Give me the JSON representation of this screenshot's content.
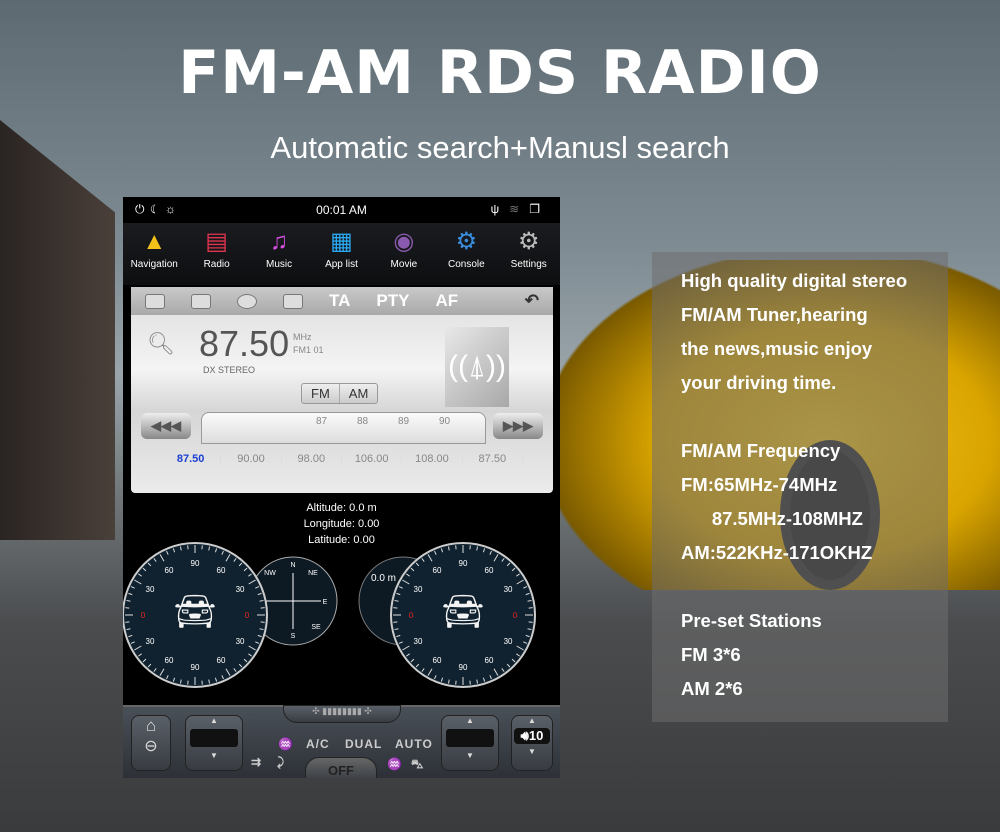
{
  "headline": "FM-AM RDS RADIO",
  "subheadline": "Automatic search+Manusl search",
  "screen": {
    "status": {
      "time": "00:01 AM",
      "left_icons": [
        "power-icon",
        "night-mode-icon",
        "brightness-icon"
      ],
      "right_icons": [
        "usb-icon",
        "wifi-icon",
        "recent-apps-icon"
      ]
    },
    "apps": [
      {
        "label": "Navigation",
        "icon": "▲",
        "color": "#f2c21a"
      },
      {
        "label": "Radio",
        "icon": "▤",
        "color": "#e0344f"
      },
      {
        "label": "Music",
        "icon": "♫",
        "color": "#d84fe0"
      },
      {
        "label": "App list",
        "icon": "▦",
        "color": "#29a7f0"
      },
      {
        "label": "Movie",
        "icon": "◉",
        "color": "#8a5ab0"
      },
      {
        "label": "Console",
        "icon": "⚙",
        "color": "#3a8ee0"
      },
      {
        "label": "Settings",
        "icon": "⚙",
        "color": "#bbbbbb"
      }
    ],
    "radio": {
      "toolbar": [
        "TA",
        "PTY",
        "AF"
      ],
      "frequency": "87.50",
      "unit": "MHz",
      "band_preset": "FM1  01",
      "flags": "DX  STEREO",
      "band_buttons": [
        "FM",
        "AM"
      ],
      "dial_labels": [
        "87",
        "88",
        "89",
        "90"
      ],
      "presets": [
        "87.50",
        "90.00",
        "98.00",
        "106.00",
        "108.00",
        "87.50"
      ],
      "seek_back": "◀◀◀",
      "seek_forward": "▶▶▶"
    },
    "gps": {
      "altitude_label": "Altitude:",
      "altitude": "0.0 m",
      "longitude_label": "Longitude:",
      "longitude": "0.00",
      "latitude_label": "Latitude:",
      "latitude": "0.00"
    },
    "gauges": {
      "scale": [
        "90",
        "60",
        "30",
        "0",
        "30",
        "60",
        "90",
        "60",
        "30",
        "0",
        "30",
        "60"
      ],
      "compass": [
        "N",
        "NE",
        "E",
        "SE",
        "S",
        "NW"
      ],
      "altimeter": "0.0 m"
    },
    "climate": {
      "ac": "A/C",
      "dual": "DUAL",
      "auto": "AUTO",
      "off": "OFF",
      "volume": "10"
    }
  },
  "info": {
    "para1": [
      "High quality digital stereo",
      "FM/AM Tuner,hearing",
      "the news,music enjoy",
      "your driving time."
    ],
    "para2": [
      "FM/AM Frequency",
      "FM:65MHz-74MHz",
      "      87.5MHz-108MHZ",
      "AM:522KHz-171OKHZ"
    ],
    "para3": [
      "Pre-set Stations",
      "FM 3*6",
      "AM 2*6"
    ]
  }
}
